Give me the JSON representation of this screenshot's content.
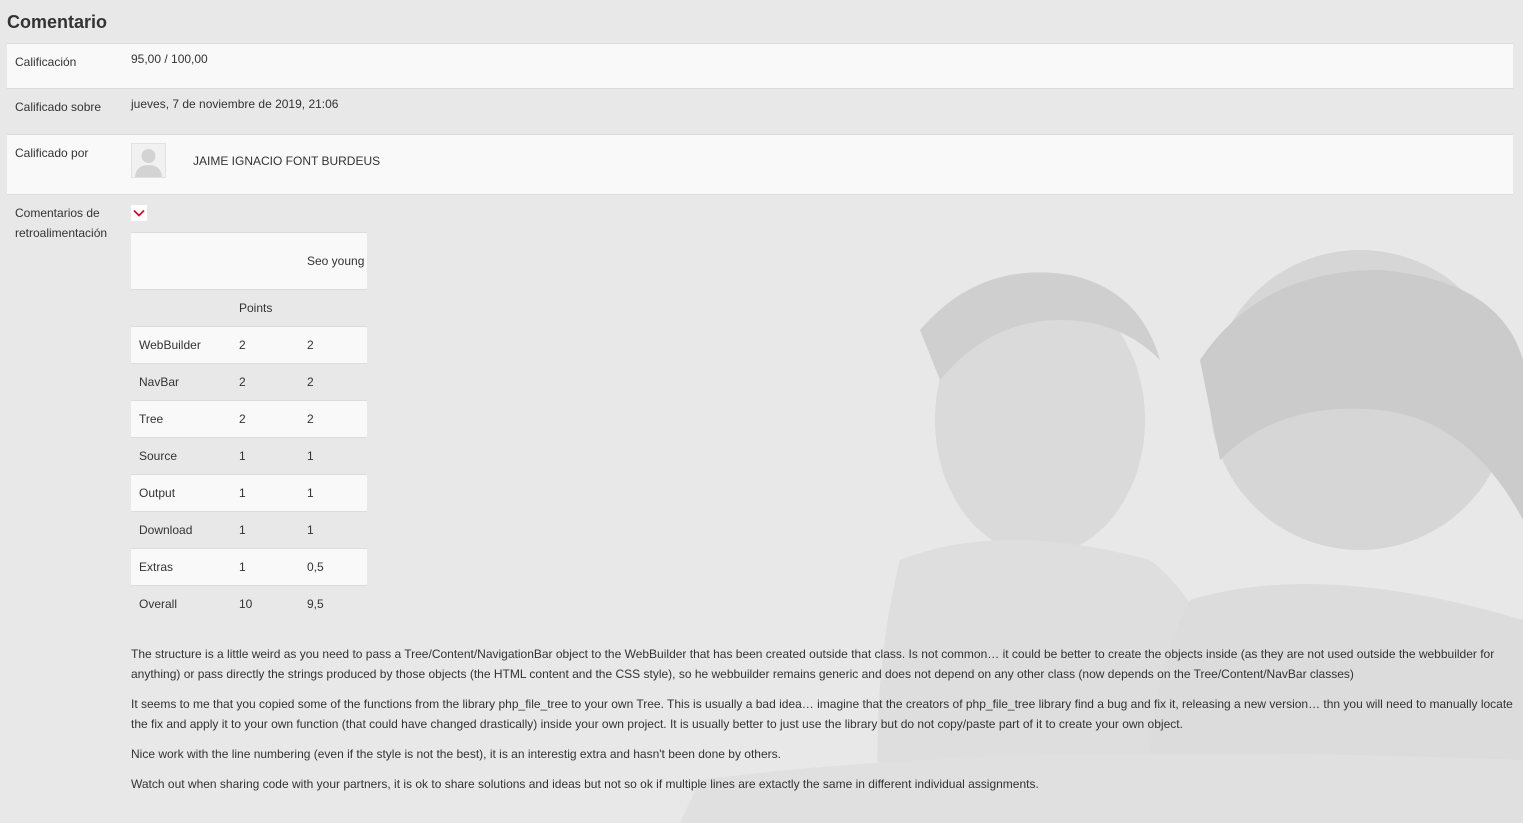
{
  "section": {
    "title": "Comentario"
  },
  "grade": {
    "label": "Calificación",
    "value": "95,00 / 100,00"
  },
  "graded_on": {
    "label": "Calificado sobre",
    "value": "jueves, 7 de noviembre de 2019, 21:06"
  },
  "graded_by": {
    "label": "Calificado por",
    "name": "JAIME IGNACIO FONT BURDEUS"
  },
  "feedback": {
    "label": "Comentarios de retroalimentación",
    "toggle_icon": "chevron-down-icon",
    "rubric": {
      "header_student": "Seo young",
      "header_points": "Points",
      "rows": [
        {
          "criterion": "WebBuilder",
          "points": "2",
          "score": "2"
        },
        {
          "criterion": "NavBar",
          "points": "2",
          "score": "2"
        },
        {
          "criterion": "Tree",
          "points": "2",
          "score": "2"
        },
        {
          "criterion": "Source",
          "points": "1",
          "score": "1"
        },
        {
          "criterion": "Output",
          "points": "1",
          "score": "1"
        },
        {
          "criterion": "Download",
          "points": "1",
          "score": "1"
        },
        {
          "criterion": "Extras",
          "points": "1",
          "score": "0,5"
        },
        {
          "criterion": "Overall",
          "points": "10",
          "score": "9,5"
        }
      ]
    },
    "comments": [
      "The structure is a little weird as you need to pass a Tree/Content/NavigationBar object to the WebBuilder that has been created outside that class. Is not common… it could be better to create the objects inside (as they are not used outside the webbuilder for anything) or pass directly the strings produced by those objects (the HTML content and the CSS style), so he webbuilder remains generic and does not depend on any other class (now depends on the Tree/Content/NavBar classes)",
      "It seems to me that you copied some of the functions from the library php_file_tree to your own Tree. This is usually a bad idea… imagine that the creators of php_file_tree library find a bug and fix it, releasing a new version… thn you will need to manually locate the fix and apply it to your own function (that could have changed drastically) inside your own project. It is usually better to just use the library but do not copy/paste part of it to create your own object.",
      "Nice work with the line numbering (even if the style is not the best), it is an interestig extra and hasn't been done by others.",
      "Watch out when sharing code with your partners, it is ok to share solutions and ideas but not so ok if multiple lines are extactly the same in different individual assignments."
    ]
  },
  "colors": {
    "page_background": "#e8e8e8",
    "row_background": "#fafafa",
    "text": "#333333",
    "accent": "#c8102e"
  }
}
